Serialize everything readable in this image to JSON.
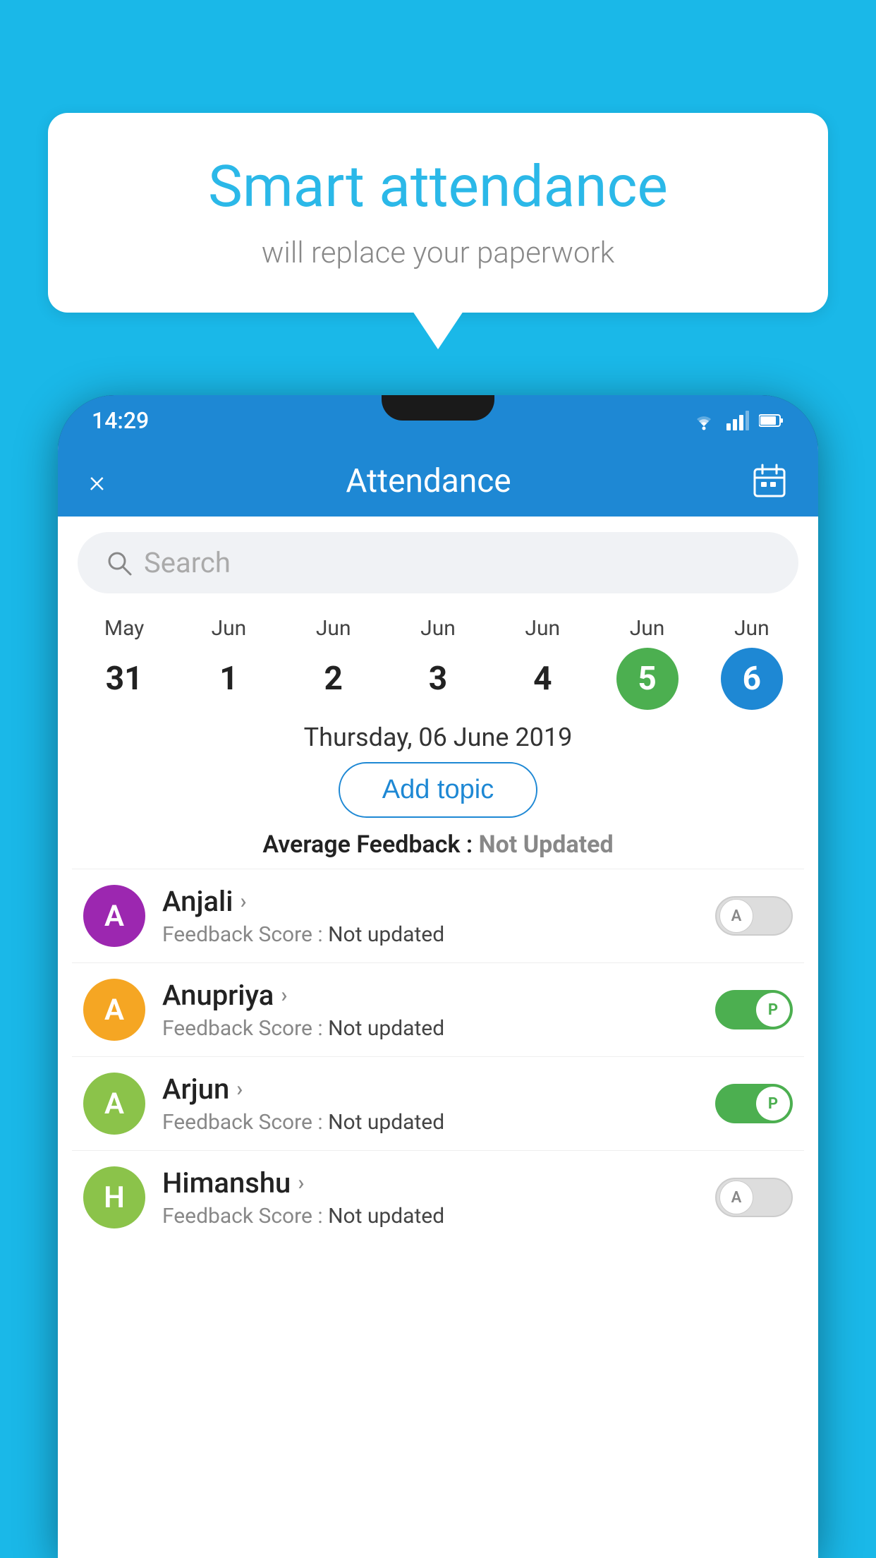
{
  "background_color": "#1ab8e8",
  "bubble": {
    "title": "Smart attendance",
    "subtitle": "will replace your paperwork"
  },
  "status_bar": {
    "time": "14:29",
    "icons": [
      "wifi",
      "signal",
      "battery"
    ]
  },
  "header": {
    "close_label": "×",
    "title": "Attendance",
    "calendar_icon": "📅"
  },
  "search": {
    "placeholder": "Search"
  },
  "calendar": {
    "days": [
      {
        "month": "May",
        "date": "31",
        "selected": false
      },
      {
        "month": "Jun",
        "date": "1",
        "selected": false
      },
      {
        "month": "Jun",
        "date": "2",
        "selected": false
      },
      {
        "month": "Jun",
        "date": "3",
        "selected": false
      },
      {
        "month": "Jun",
        "date": "4",
        "selected": false
      },
      {
        "month": "Jun",
        "date": "5",
        "selected": "green"
      },
      {
        "month": "Jun",
        "date": "6",
        "selected": "blue"
      }
    ]
  },
  "selected_date": "Thursday, 06 June 2019",
  "add_topic_label": "Add topic",
  "avg_feedback_label": "Average Feedback :",
  "avg_feedback_value": "Not Updated",
  "students": [
    {
      "name": "Anjali",
      "avatar_letter": "A",
      "avatar_color": "#9c27b0",
      "feedback_label": "Feedback Score :",
      "feedback_value": "Not updated",
      "toggle": "off",
      "toggle_letter": "A"
    },
    {
      "name": "Anupriya",
      "avatar_letter": "A",
      "avatar_color": "#f5a623",
      "feedback_label": "Feedback Score :",
      "feedback_value": "Not updated",
      "toggle": "on",
      "toggle_letter": "P"
    },
    {
      "name": "Arjun",
      "avatar_letter": "A",
      "avatar_color": "#8bc34a",
      "feedback_label": "Feedback Score :",
      "feedback_value": "Not updated",
      "toggle": "on",
      "toggle_letter": "P"
    },
    {
      "name": "Himanshu",
      "avatar_letter": "H",
      "avatar_color": "#8bc34a",
      "feedback_label": "Feedback Score :",
      "feedback_value": "Not updated",
      "toggle": "off",
      "toggle_letter": "A"
    }
  ]
}
